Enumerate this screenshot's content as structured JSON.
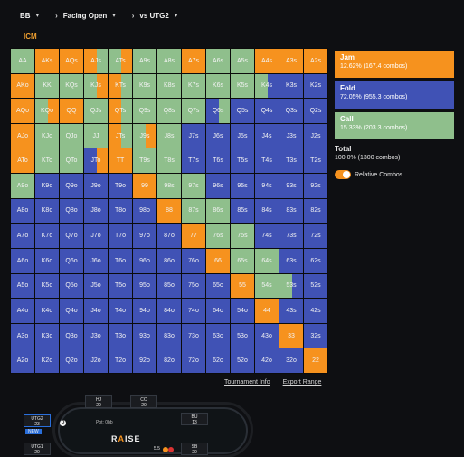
{
  "topbar": {
    "position": "BB",
    "action": "Facing Open",
    "opponent": "vs UTG2"
  },
  "mode_label": "ICM",
  "colors": {
    "jam": "#f6921e",
    "fold": "#4052b5",
    "call": "#8fbf8c"
  },
  "grid_labels": [
    [
      "AA",
      "AKs",
      "AQs",
      "AJs",
      "ATs",
      "A9s",
      "A8s",
      "A7s",
      "A6s",
      "A5s",
      "A4s",
      "A3s",
      "A2s"
    ],
    [
      "AKo",
      "KK",
      "KQs",
      "KJs",
      "KTs",
      "K9s",
      "K8s",
      "K7s",
      "K6s",
      "K5s",
      "K4s",
      "K3s",
      "K2s"
    ],
    [
      "AQo",
      "KQo",
      "QQ",
      "QJs",
      "QTs",
      "Q9s",
      "Q8s",
      "Q7s",
      "Q6s",
      "Q5s",
      "Q4s",
      "Q3s",
      "Q2s"
    ],
    [
      "AJo",
      "KJo",
      "QJo",
      "JJ",
      "JTs",
      "J9s",
      "J8s",
      "J7s",
      "J6s",
      "J5s",
      "J4s",
      "J3s",
      "J2s"
    ],
    [
      "ATo",
      "KTo",
      "QTo",
      "JTo",
      "TT",
      "T9s",
      "T8s",
      "T7s",
      "T6s",
      "T5s",
      "T4s",
      "T3s",
      "T2s"
    ],
    [
      "A9o",
      "K9o",
      "Q9o",
      "J9o",
      "T9o",
      "99",
      "98s",
      "97s",
      "96s",
      "95s",
      "94s",
      "93s",
      "92s"
    ],
    [
      "A8o",
      "K8o",
      "Q8o",
      "J8o",
      "T8o",
      "98o",
      "88",
      "87s",
      "86s",
      "85s",
      "84s",
      "83s",
      "82s"
    ],
    [
      "A7o",
      "K7o",
      "Q7o",
      "J7o",
      "T7o",
      "97o",
      "87o",
      "77",
      "76s",
      "75s",
      "74s",
      "73s",
      "72s"
    ],
    [
      "A6o",
      "K6o",
      "Q6o",
      "J6o",
      "T6o",
      "96o",
      "86o",
      "76o",
      "66",
      "65s",
      "64s",
      "63s",
      "62s"
    ],
    [
      "A5o",
      "K5o",
      "Q5o",
      "J5o",
      "T5o",
      "95o",
      "85o",
      "75o",
      "65o",
      "55",
      "54s",
      "53s",
      "52s"
    ],
    [
      "A4o",
      "K4o",
      "Q4o",
      "J4o",
      "T4o",
      "94o",
      "84o",
      "74o",
      "64o",
      "54o",
      "44",
      "43s",
      "42s"
    ],
    [
      "A3o",
      "K3o",
      "Q3o",
      "J3o",
      "T3o",
      "93o",
      "83o",
      "73o",
      "63o",
      "53o",
      "43o",
      "33",
      "32s"
    ],
    [
      "A2o",
      "K2o",
      "Q2o",
      "J2o",
      "T2o",
      "92o",
      "82o",
      "72o",
      "62o",
      "52o",
      "42o",
      "32o",
      "22"
    ]
  ],
  "grid_actions": [
    [
      "C",
      "J",
      "J",
      "JC",
      "CJ",
      "C",
      "C",
      "J",
      "C",
      "C",
      "J",
      "J",
      "J"
    ],
    [
      "J",
      "C",
      "C",
      "CJ",
      "JC",
      "C",
      "C",
      "C",
      "C",
      "C",
      "CF",
      "F",
      "F"
    ],
    [
      "J",
      "CJ",
      "J",
      "C",
      "JC",
      "C",
      "C",
      "C",
      "FC",
      "F",
      "F",
      "F",
      "F"
    ],
    [
      "J",
      "C",
      "C",
      "C",
      "JC",
      "CJ",
      "C",
      "F",
      "F",
      "F",
      "F",
      "F",
      "F"
    ],
    [
      "J",
      "C",
      "C",
      "FJ",
      "J",
      "C",
      "C",
      "F",
      "F",
      "F",
      "F",
      "F",
      "F"
    ],
    [
      "C",
      "F",
      "F",
      "F",
      "F",
      "J",
      "C",
      "C",
      "F",
      "F",
      "F",
      "F",
      "F"
    ],
    [
      "F",
      "F",
      "F",
      "F",
      "F",
      "F",
      "J",
      "C",
      "C",
      "F",
      "F",
      "F",
      "F"
    ],
    [
      "F",
      "F",
      "F",
      "F",
      "F",
      "F",
      "F",
      "J",
      "C",
      "C",
      "F",
      "F",
      "F"
    ],
    [
      "F",
      "F",
      "F",
      "F",
      "F",
      "F",
      "F",
      "F",
      "J",
      "C",
      "C",
      "F",
      "F"
    ],
    [
      "F",
      "F",
      "F",
      "F",
      "F",
      "F",
      "F",
      "F",
      "F",
      "J",
      "C",
      "CF",
      "F"
    ],
    [
      "F",
      "F",
      "F",
      "F",
      "F",
      "F",
      "F",
      "F",
      "F",
      "F",
      "J",
      "F",
      "F"
    ],
    [
      "F",
      "F",
      "F",
      "F",
      "F",
      "F",
      "F",
      "F",
      "F",
      "F",
      "F",
      "J",
      "F"
    ],
    [
      "F",
      "F",
      "F",
      "F",
      "F",
      "F",
      "F",
      "F",
      "F",
      "F",
      "F",
      "F",
      "J"
    ]
  ],
  "legend": {
    "jam": {
      "title": "Jam",
      "detail": "12.62% (167.4 combos)"
    },
    "fold": {
      "title": "Fold",
      "detail": "72.05% (955.3 combos)"
    },
    "call": {
      "title": "Call",
      "detail": "15.33% (203.3 combos)"
    },
    "total": {
      "title": "Total",
      "detail": "100.0% (1300 combos)"
    },
    "relative_toggle": "Relative Combos"
  },
  "links": {
    "info": "Tournament Info",
    "export": "Export Range"
  },
  "table": {
    "brand_left": "R",
    "brand_accent": "A",
    "brand_right": "ISE",
    "pot_label": "Pot: 0bb",
    "seats": [
      {
        "name": "HJ",
        "stack": "20"
      },
      {
        "name": "CO",
        "stack": "20"
      },
      {
        "name": "UTG2",
        "stack": "23"
      },
      {
        "name": "BU",
        "stack": "13"
      },
      {
        "name": "UTG1",
        "stack": "20"
      },
      {
        "name": "SB",
        "stack": "20"
      }
    ],
    "hero_badge": "NEW",
    "bet_label": "5.5"
  }
}
